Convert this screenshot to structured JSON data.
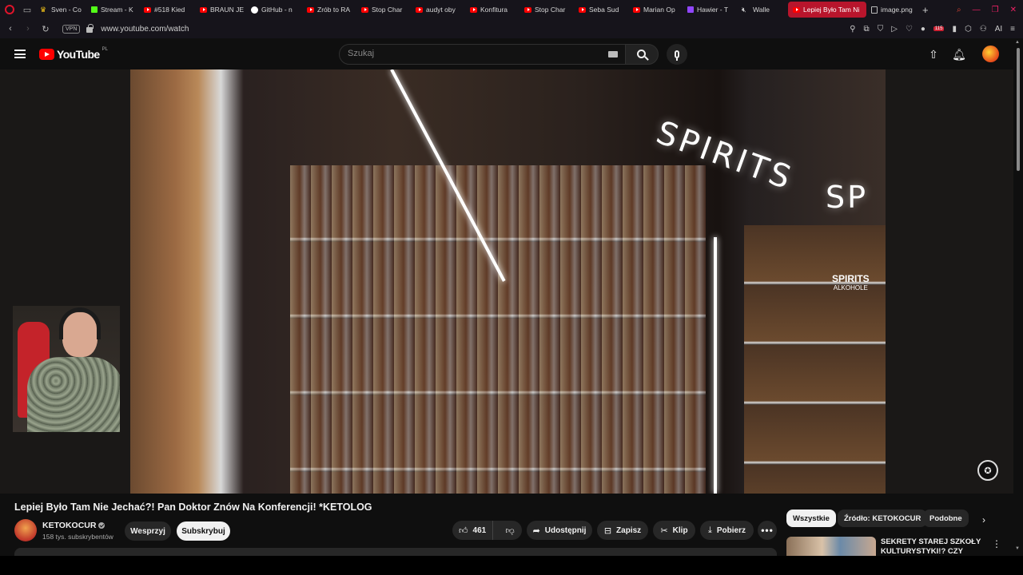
{
  "browser": {
    "tabs": [
      {
        "label": "Sven - Co",
        "icon": "crown-icon"
      },
      {
        "label": "Stream - K",
        "icon": "kick-icon"
      },
      {
        "label": "#518 Kied",
        "icon": "youtube-icon"
      },
      {
        "label": "BRAUN JE",
        "icon": "youtube-icon"
      },
      {
        "label": "GitHub - n",
        "icon": "github-icon"
      },
      {
        "label": "Zrób to RA",
        "icon": "youtube-icon"
      },
      {
        "label": "Stop Char",
        "icon": "youtube-icon"
      },
      {
        "label": "audyt oby",
        "icon": "youtube-icon"
      },
      {
        "label": "Konfitura",
        "icon": "youtube-icon"
      },
      {
        "label": "Stop Char",
        "icon": "youtube-icon"
      },
      {
        "label": "Seba Sud",
        "icon": "youtube-icon"
      },
      {
        "label": "Marian Op",
        "icon": "youtube-icon"
      },
      {
        "label": "Hawier - T",
        "icon": "twitch-icon"
      },
      {
        "label": "Walle",
        "icon": "muted-speaker-icon"
      },
      {
        "label": "Lepiej Było Tam Ni",
        "icon": "youtube-icon",
        "active": true
      },
      {
        "label": "image.png",
        "icon": "image-file-icon"
      }
    ],
    "new_tab_label": "+",
    "url": "www.youtube.com/watch",
    "vpn_label": "VPN",
    "ext_badge": "115",
    "ai_label": "AI",
    "accent_color": "#b8152c"
  },
  "youtube": {
    "logo_text": "YouTube",
    "country_code": "PL",
    "search_placeholder": "Szukaj"
  },
  "video": {
    "sign_text": "SPIRITS",
    "sign_text_2": "SP",
    "cabinet_label": "SPIRITS",
    "cabinet_sublabel": "ALKOHOLE",
    "title": "Lepiej Było Tam Nie Jechać?! Pan Doktor Znów Na Konferencji! *KETOLOG"
  },
  "channel": {
    "name": "KETOKOCUR",
    "subscribers": "158 tys. subskrybentów",
    "support_label": "Wesprzyj",
    "subscribe_label": "Subskrybuj"
  },
  "actions": {
    "likes": "461",
    "share_label": "Udostępnij",
    "save_label": "Zapisz",
    "clip_label": "Klip",
    "download_label": "Pobierz"
  },
  "sidebar": {
    "chips": [
      "Wszystkie",
      "Źródło: KETOKOCUR",
      "Podobne"
    ],
    "active_chip": "Wszystkie",
    "recommendation_title": "SEKRETY STAREJ SZKOŁY KULTURYSTYKI!? CZY KIEDYŚ"
  }
}
